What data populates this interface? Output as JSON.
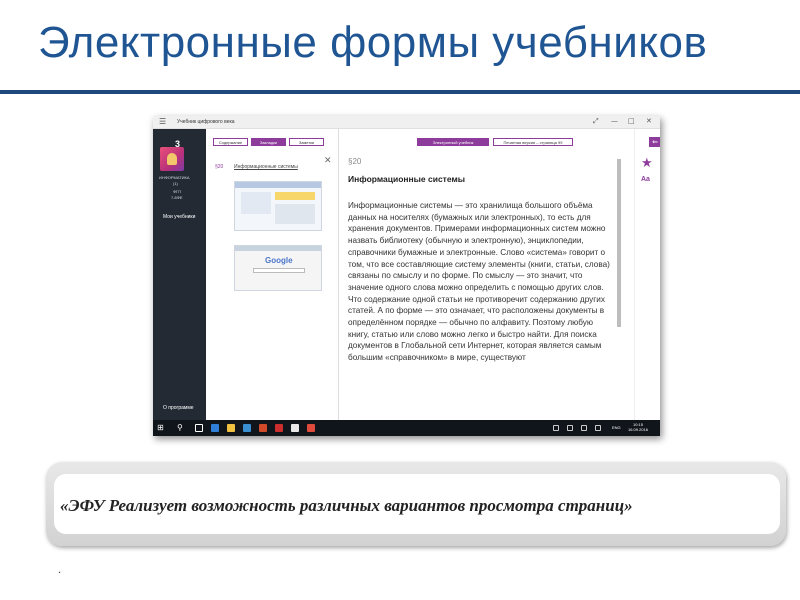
{
  "slide": {
    "title": "Электронные формы учебников",
    "caption": "«ЭФУ Реализует возможность различных вариантов просмотра страниц»",
    "bullet": "."
  },
  "app": {
    "window_title": "Учебник цифрового века",
    "controls": {
      "back": "☰",
      "restore": "⤢",
      "minimize": "—",
      "maximize": "□",
      "close": "✕"
    },
    "sidebar": {
      "grade": "3",
      "subject": "ИНФОРМАТИКА",
      "part": "(1)",
      "info1": "ФГП",
      "info2": "7-8ФЕ",
      "my_textbooks": "Мои учебники",
      "about": "О программе"
    },
    "bookmarks_pane": {
      "tabs": [
        "Содержание",
        "Закладки",
        "Заметки"
      ],
      "active_tab": "Закладки",
      "close": "✕",
      "section": "§20",
      "heading": "Информационные системы",
      "thumb_logo": "Google"
    },
    "reader": {
      "tabs": [
        "Электронный учебник",
        "Печатная версия – страница 99"
      ],
      "active_tab": "Электронный учебник",
      "paragraph_number": "§20",
      "paragraph_title": "Информационные системы",
      "body": "Информационные системы — это хранилища большого объёма данных на носителях (бумажных или электронных), то есть для хранения документов. Примерами информационных систем можно назвать библиотеку (обычную и электронную), энциклопедии, справочники бумажные и электронные. Слово «система» говорит о том, что все составляющие систему элементы (книги, статьи, слова) связаны по смыслу и по форме. По смыслу — это значит, что значение одного слова можно определить с помощью других слов. Что содержание одной статьи не противоречит содержанию других статей. А по форме — это означает, что расположены документы в определённом порядке — обычно по алфавиту. Поэтому любую книгу, статью или слово можно легко и быстро найти. Для поиска документов в Глобальной сети Интернет, которая является самым большим «справочником» в мире, существуют"
    },
    "right_strip": {
      "back": "⇐",
      "bookmark": "★",
      "font": "Aa"
    },
    "taskbar": {
      "start": "⊞",
      "search": "⚲",
      "lang": "ENG",
      "time": "10:15",
      "date": "16.09.2016"
    }
  },
  "colors": {
    "title": "#1f5593",
    "rule": "#1f497d",
    "accent": "#8e3c9c",
    "sidebar": "#232a33",
    "taskbar": "#10151b"
  }
}
